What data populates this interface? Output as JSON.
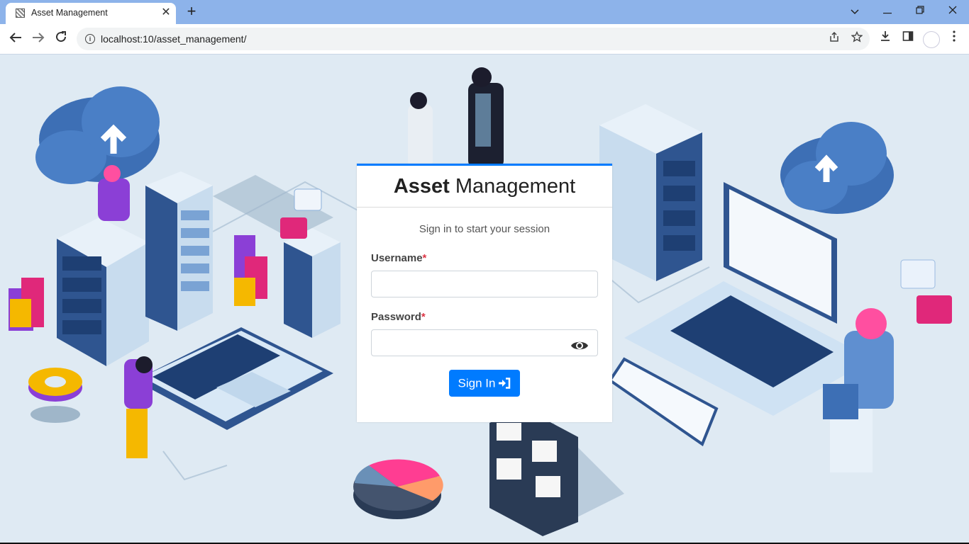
{
  "browser": {
    "tab_title": "Asset Management",
    "tab_close": "✕",
    "new_tab": "+",
    "url": "localhost:10/asset_management/",
    "window_controls": {
      "dropdown": "⌄",
      "minimize": "—",
      "restore": "❐",
      "close": "✕"
    },
    "icons": [
      "back-arrow-icon",
      "forward-arrow-icon",
      "reload-icon",
      "site-info-icon",
      "share-icon",
      "star-icon",
      "download-icon",
      "side-panel-icon",
      "profile-avatar",
      "kebab-menu-icon"
    ]
  },
  "login": {
    "brand_bold": "Asset",
    "brand_rest": " Management",
    "subtitle": "Sign in to start your session",
    "username_label": "Username",
    "password_label": "Password",
    "required_mark": "*",
    "username_value": "",
    "password_value": "",
    "signin_label": "Sign In"
  },
  "theme": {
    "accent": "#007bff",
    "required": "#dc3545",
    "page_background": "#dfeaf3",
    "tabbar": "#8db3ea"
  },
  "illustration": {
    "description_icons": [
      "cloud-upload-icon",
      "server-rack",
      "laptop",
      "pie-chart",
      "bar-blocks",
      "people",
      "chat-bubble-icon"
    ]
  }
}
